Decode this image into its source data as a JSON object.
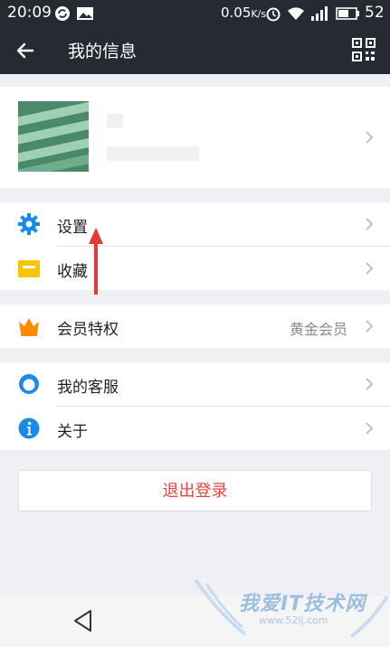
{
  "status_bar": {
    "time": "20:09",
    "network_speed": "0.05",
    "speed_unit": "K/s",
    "battery": "52",
    "icons": [
      "sync-icon",
      "image-icon",
      "alarm-icon",
      "wifi-icon",
      "signal-icon",
      "battery-icon"
    ]
  },
  "app_bar": {
    "title": "我的信息",
    "back_icon": "back-arrow-icon",
    "qr_icon": "qr-code-icon"
  },
  "menu": {
    "settings": {
      "label": "设置",
      "icon": "gear-icon",
      "color": "#1a8ae8"
    },
    "favorites": {
      "label": "收藏",
      "icon": "folder-icon",
      "color": "#f7c400"
    },
    "vip": {
      "label": "会员特权",
      "value": "黄金会员",
      "icon": "crown-icon",
      "color": "#ff8a00"
    },
    "service": {
      "label": "我的客服",
      "icon": "headset-icon",
      "color": "#1a8ae8"
    },
    "about": {
      "label": "关于",
      "icon": "info-icon",
      "color": "#1a8ae8"
    }
  },
  "logout": {
    "label": "退出登录",
    "color": "#e64340"
  },
  "annotation": {
    "arrow_color": "#e53935"
  },
  "watermark": {
    "text": "我爱IT技术网",
    "url": "www.52ij.com"
  }
}
